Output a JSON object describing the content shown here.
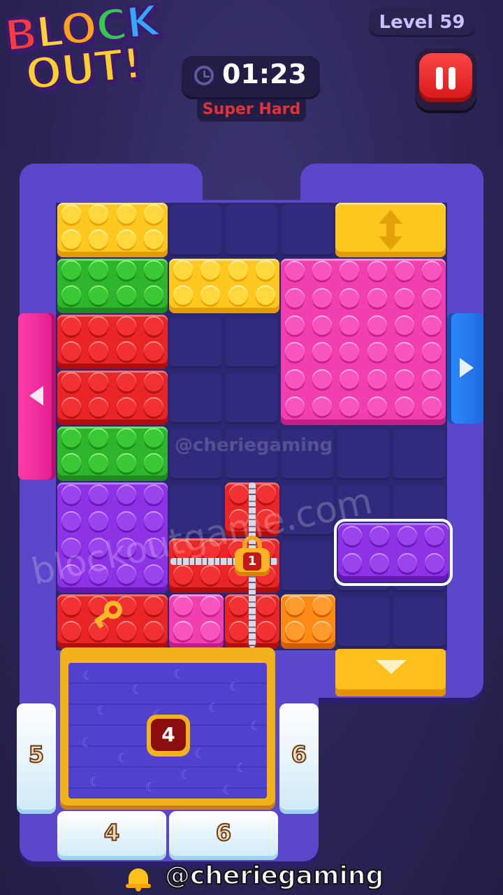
{
  "header": {
    "logo_line1": "BLOCK",
    "logo_line2": "OUT!",
    "level_label": "Level 59",
    "timer": "01:23",
    "difficulty": "Super Hard"
  },
  "board": {
    "lock_number": "1",
    "bin_count": "4",
    "ice_counters": {
      "left": "5",
      "right": "6",
      "bottom_left": "4",
      "bottom_right": "6"
    }
  },
  "watermarks": {
    "overlay_handle": "@cheriegaming",
    "overlay_site": "blockoutgame.com"
  },
  "footer": {
    "handle": "@cheriegaming"
  },
  "colors": {
    "yellow": "#ffc81f",
    "green": "#2fb52c",
    "red": "#ea2525",
    "pink": "#f23fb0",
    "purple": "#8e32e6",
    "orange": "#ff8a14",
    "gate_pink": "#ff3ea8",
    "gate_blue": "#2f8cff",
    "gate_yellow": "#ffbe1a"
  },
  "icons": [
    "clock-icon",
    "pause-icon",
    "double-arrow-icon",
    "arrow-left-icon",
    "arrow-right-icon",
    "arrow-down-icon",
    "padlock-icon",
    "key-icon",
    "moon-icon",
    "bell-icon"
  ]
}
